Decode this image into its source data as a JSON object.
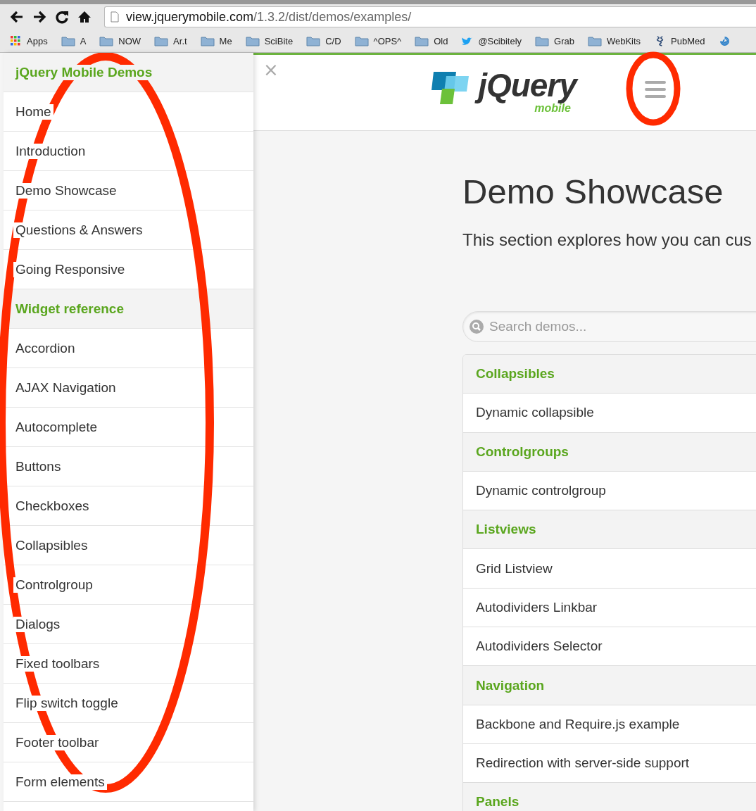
{
  "browser": {
    "url_host": "view.jquerymobile.com",
    "url_path": "/1.3.2/dist/demos/examples/",
    "bookmarks": [
      {
        "kind": "apps",
        "label": "Apps"
      },
      {
        "kind": "folder",
        "label": "A"
      },
      {
        "kind": "folder",
        "label": "NOW"
      },
      {
        "kind": "folder",
        "label": "Ar.t"
      },
      {
        "kind": "folder",
        "label": "Me"
      },
      {
        "kind": "folder",
        "label": "SciBite"
      },
      {
        "kind": "folder",
        "label": "C/D"
      },
      {
        "kind": "folder",
        "label": "^OPS^"
      },
      {
        "kind": "folder",
        "label": "Old"
      },
      {
        "kind": "bird",
        "label": "@Scibitely"
      },
      {
        "kind": "folder",
        "label": "Grab"
      },
      {
        "kind": "folder",
        "label": "WebKits"
      },
      {
        "kind": "helix",
        "label": "PubMed"
      },
      {
        "kind": "spiral"
      }
    ]
  },
  "sidebar": {
    "items": [
      {
        "kind": "header",
        "label": "jQuery Mobile Demos"
      },
      {
        "kind": "link",
        "label": "Home"
      },
      {
        "kind": "link",
        "label": "Introduction"
      },
      {
        "kind": "link",
        "label": "Demo Showcase"
      },
      {
        "kind": "link",
        "label": "Questions & Answers"
      },
      {
        "kind": "link",
        "label": "Going Responsive"
      },
      {
        "kind": "divider",
        "label": "Widget reference"
      },
      {
        "kind": "link",
        "label": "Accordion"
      },
      {
        "kind": "link",
        "label": "AJAX Navigation"
      },
      {
        "kind": "link",
        "label": "Autocomplete"
      },
      {
        "kind": "link",
        "label": "Buttons"
      },
      {
        "kind": "link",
        "label": "Checkboxes"
      },
      {
        "kind": "link",
        "label": "Collapsibles"
      },
      {
        "kind": "link",
        "label": "Controlgroup"
      },
      {
        "kind": "link",
        "label": "Dialogs"
      },
      {
        "kind": "link",
        "label": "Fixed toolbars"
      },
      {
        "kind": "link",
        "label": "Flip switch toggle"
      },
      {
        "kind": "link",
        "label": "Footer toolbar"
      },
      {
        "kind": "link",
        "label": "Form elements"
      }
    ]
  },
  "header": {
    "close": "×",
    "logo_word": "jQuery",
    "logo_sub": "mobile"
  },
  "content": {
    "title": "Demo Showcase",
    "intro": "This section explores how you can cus",
    "search": {
      "placeholder": "Search demos..."
    },
    "list": [
      {
        "kind": "divider",
        "label": "Collapsibles"
      },
      {
        "kind": "link",
        "label": "Dynamic collapsible"
      },
      {
        "kind": "divider",
        "label": "Controlgroups"
      },
      {
        "kind": "link",
        "label": "Dynamic controlgroup"
      },
      {
        "kind": "divider",
        "label": "Listviews"
      },
      {
        "kind": "link",
        "label": "Grid Listview"
      },
      {
        "kind": "link",
        "label": "Autodividers Linkbar"
      },
      {
        "kind": "link",
        "label": "Autodividers Selector"
      },
      {
        "kind": "divider",
        "label": "Navigation"
      },
      {
        "kind": "link",
        "label": "Backbone and Require.js example"
      },
      {
        "kind": "link",
        "label": "Redirection with server-side support"
      },
      {
        "kind": "divider",
        "label": "Panels"
      }
    ]
  },
  "annotations": [
    {
      "kind": "ellipse"
    },
    {
      "kind": "ellipse"
    }
  ]
}
